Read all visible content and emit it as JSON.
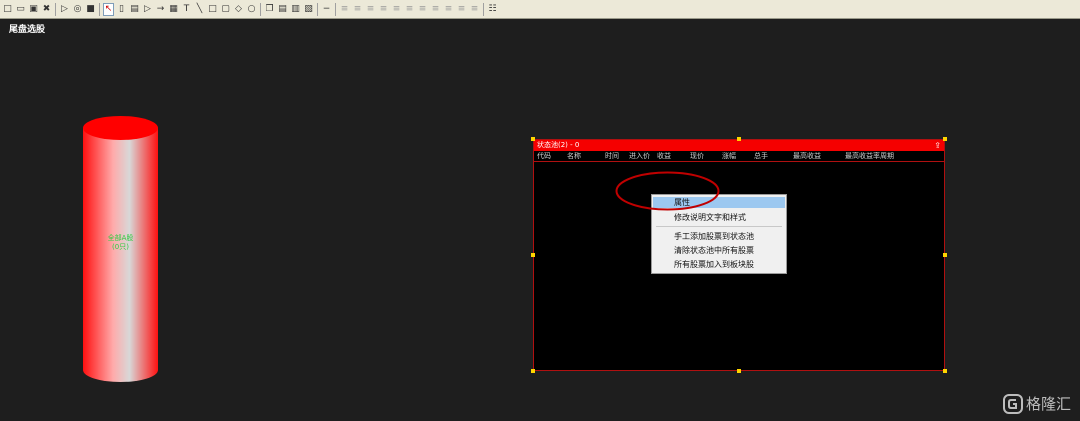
{
  "toolbar": {
    "buttons": [
      {
        "name": "new-doc-icon",
        "glyph": "□"
      },
      {
        "name": "open-icon",
        "glyph": "▭"
      },
      {
        "name": "save-icon",
        "glyph": "▣"
      },
      {
        "name": "close-x-icon",
        "glyph": "✖"
      },
      {
        "name": "play-icon",
        "glyph": "▷"
      },
      {
        "name": "record-icon",
        "glyph": "◎"
      },
      {
        "name": "stop-icon",
        "glyph": "■"
      },
      {
        "name": "pointer-icon",
        "glyph": "↖"
      },
      {
        "name": "ellipse-tool-icon",
        "glyph": "▯"
      },
      {
        "name": "panel-tool-icon",
        "glyph": "▤"
      },
      {
        "name": "triangle-tool-icon",
        "glyph": "▷"
      },
      {
        "name": "arrow-tool-icon",
        "glyph": "→"
      },
      {
        "name": "table-tool-icon",
        "glyph": "▦"
      },
      {
        "name": "text-tool-icon",
        "glyph": "T"
      },
      {
        "name": "line-tool-icon",
        "glyph": "╲"
      },
      {
        "name": "rectangle-tool-icon",
        "glyph": "□"
      },
      {
        "name": "rounded-rect-tool-icon",
        "glyph": "▢"
      },
      {
        "name": "diamond-tool-icon",
        "glyph": "◇"
      },
      {
        "name": "circle-tool-icon",
        "glyph": "○"
      },
      {
        "name": "copy-icon",
        "glyph": "❐"
      },
      {
        "name": "paste-icon",
        "glyph": "▤"
      },
      {
        "name": "delete-icon",
        "glyph": "▥"
      },
      {
        "name": "properties-icon",
        "glyph": "▧"
      },
      {
        "name": "minus-icon",
        "glyph": "−"
      },
      {
        "name": "align-left-icon",
        "glyph": "≡"
      },
      {
        "name": "align-center-icon",
        "glyph": "≡"
      },
      {
        "name": "align-right-icon",
        "glyph": "≡"
      },
      {
        "name": "align-top-icon",
        "glyph": "≡"
      },
      {
        "name": "align-middle-icon",
        "glyph": "≡"
      },
      {
        "name": "align-bottom-icon",
        "glyph": "≡"
      },
      {
        "name": "same-width-icon",
        "glyph": "≡"
      },
      {
        "name": "same-height-icon",
        "glyph": "≡"
      },
      {
        "name": "same-size-icon",
        "glyph": "≡"
      },
      {
        "name": "space-horizontal-icon",
        "glyph": "≡"
      },
      {
        "name": "space-vertical-icon",
        "glyph": "≡"
      },
      {
        "name": "grid-icon",
        "glyph": "☷"
      }
    ]
  },
  "canvas": {
    "title": "尾盘选股"
  },
  "cylinder": {
    "line1": "全部A股",
    "line2": "(0只)"
  },
  "panel": {
    "title": "状态池(2) - 0",
    "collapse_glyph": "⇪",
    "columns": [
      "代码",
      "名称",
      "时间",
      "进入价",
      "收益",
      "现价",
      "涨幅",
      "总手",
      "最高收益",
      "最高收益率周期"
    ]
  },
  "context_menu": {
    "items": [
      {
        "label": "属性",
        "highlighted": true
      },
      {
        "label": "修改说明文字和样式"
      },
      {
        "label": "手工添加股票到状态池"
      },
      {
        "label": "清除状态池中所有股票"
      },
      {
        "label": "所有股票加入到板块股"
      }
    ]
  },
  "watermark": {
    "text": "格隆汇"
  },
  "colors": {
    "panel_header": "#f50000",
    "annotation": "#c00000",
    "menu_highlight": "#9cc8f0",
    "handle": "#ffd500",
    "cylinder_label": "#2ecc40"
  }
}
